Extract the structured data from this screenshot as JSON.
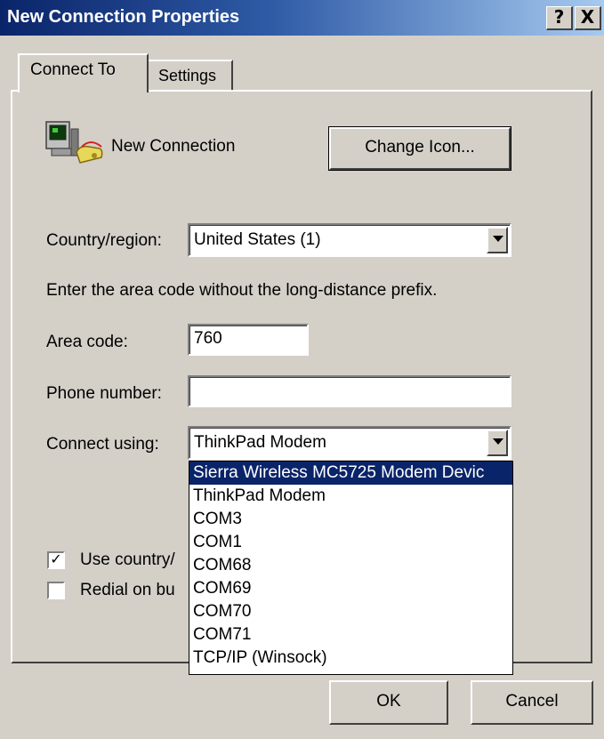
{
  "window": {
    "title": "New Connection Properties",
    "help_label": "?",
    "close_label": "X"
  },
  "tabs": [
    {
      "label": "Connect To",
      "active": true
    },
    {
      "label": "Settings",
      "active": false
    }
  ],
  "connection": {
    "icon": "phone-computer-icon",
    "name": "New Connection",
    "change_icon_label": "Change Icon..."
  },
  "country": {
    "label": "Country/region:",
    "value": "United States (1)"
  },
  "instruction": "Enter the area code without the long-distance prefix.",
  "area_code": {
    "label": "Area code:",
    "value": "760"
  },
  "phone_number": {
    "label": "Phone number:",
    "value": ""
  },
  "connect_using": {
    "label": "Connect using:",
    "value": "ThinkPad Modem",
    "options": [
      "Sierra Wireless MC5725 Modem Devic",
      "ThinkPad Modem",
      "COM3",
      "COM1",
      "COM68",
      "COM69",
      "COM70",
      "COM71",
      "TCP/IP (Winsock)"
    ],
    "highlighted_index": 0
  },
  "checkboxes": [
    {
      "label": "Use country/",
      "checked": true
    },
    {
      "label": "Redial on bu",
      "checked": false
    }
  ],
  "footer": {
    "ok_label": "OK",
    "cancel_label": "Cancel"
  },
  "colors": {
    "title_gradient_start": "#0a246a",
    "title_gradient_end": "#a6caf0",
    "face": "#d4d0c8",
    "selection": "#0a246a"
  }
}
